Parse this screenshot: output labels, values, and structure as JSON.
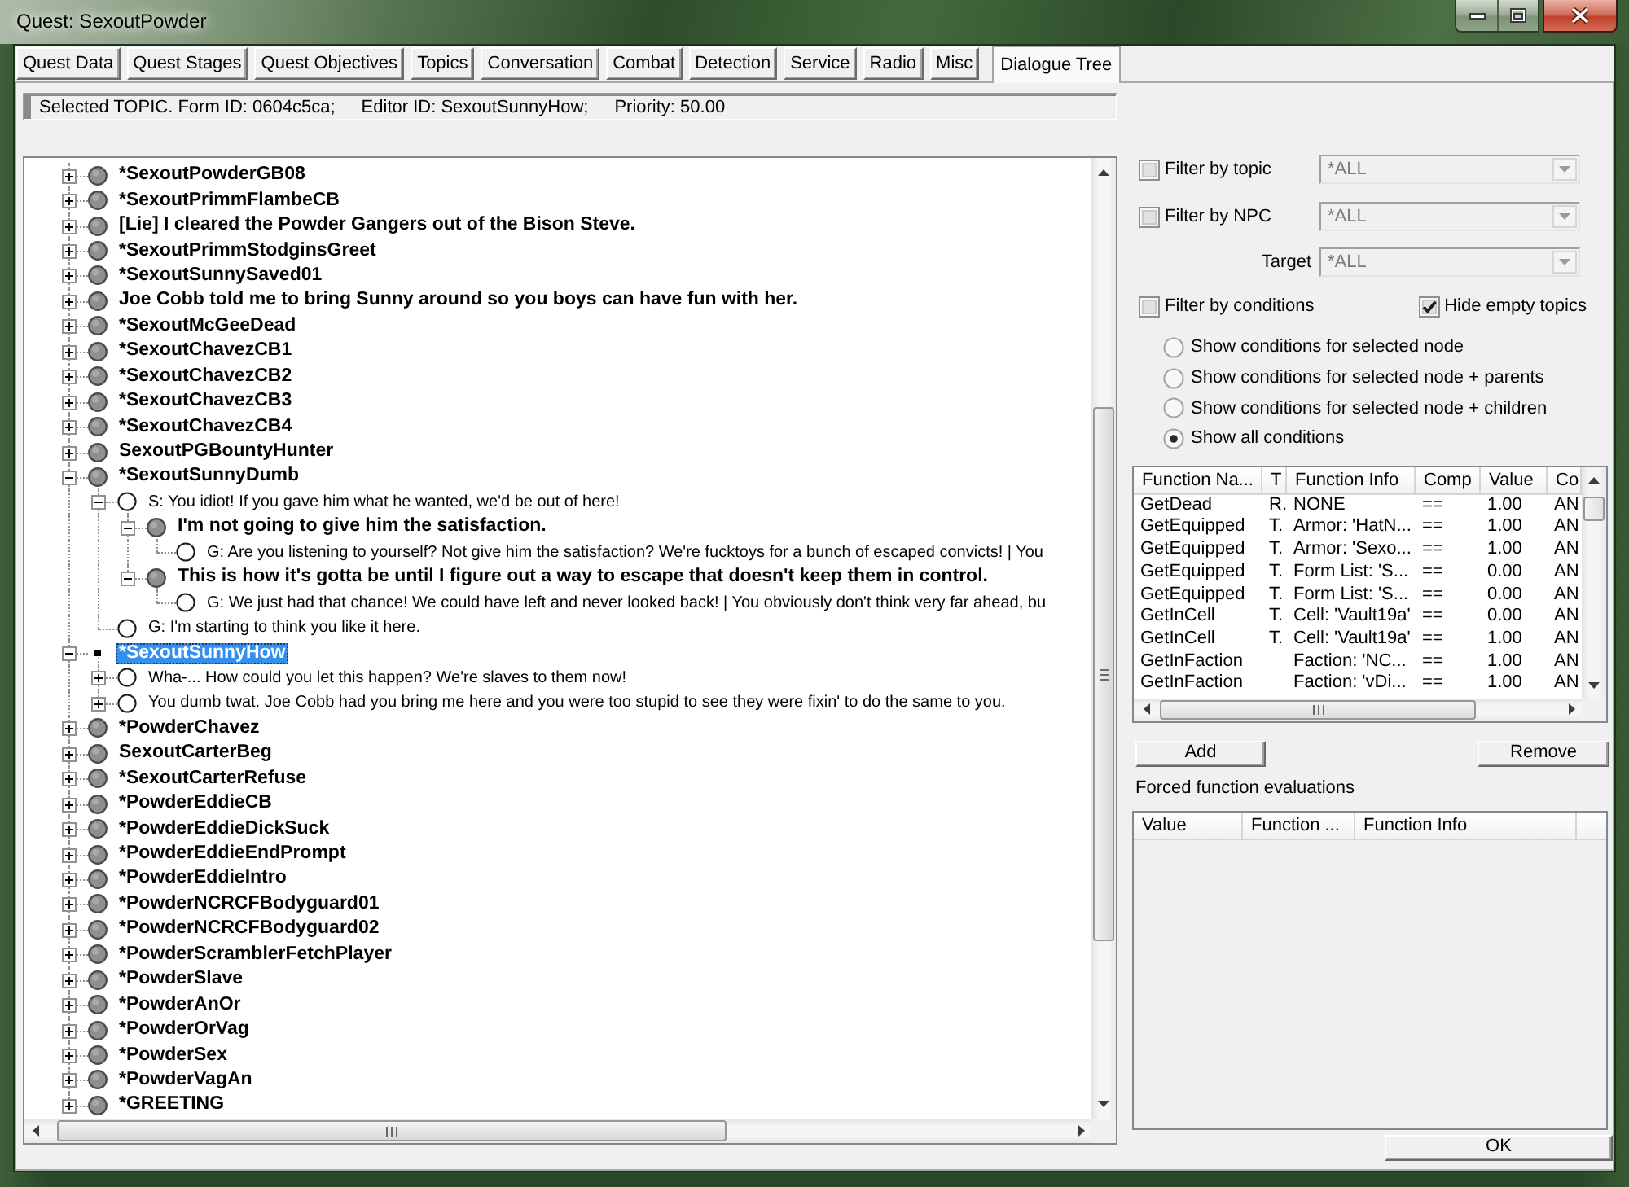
{
  "window": {
    "title": "Quest: SexoutPowder"
  },
  "tabs": [
    {
      "label": "Quest Data",
      "selected": false
    },
    {
      "label": "Quest Stages",
      "selected": false
    },
    {
      "label": "Quest Objectives",
      "selected": false
    },
    {
      "label": "Topics",
      "selected": false
    },
    {
      "label": "Conversation",
      "selected": false
    },
    {
      "label": "Combat",
      "selected": false
    },
    {
      "label": "Detection",
      "selected": false
    },
    {
      "label": "Service",
      "selected": false
    },
    {
      "label": "Radio",
      "selected": false
    },
    {
      "label": "Misc",
      "selected": false
    },
    {
      "label": "Dialogue Tree",
      "selected": true
    }
  ],
  "info_bar": [
    "Selected TOPIC. Form ID: 0604c5ca;",
    "Editor ID: SexoutSunnyHow;",
    "Priority: 50.00"
  ],
  "tree": [
    {
      "text": "*SexoutPowderGB08",
      "kind": "topic",
      "expanded": false,
      "selected": false
    },
    {
      "text": "*SexoutPrimmFlambeCB",
      "kind": "topic",
      "expanded": false,
      "selected": false
    },
    {
      "text": "[Lie] I cleared the Powder Gangers out of the Bison Steve.",
      "kind": "topic",
      "expanded": false,
      "selected": false
    },
    {
      "text": "*SexoutPrimmStodginsGreet",
      "kind": "topic",
      "expanded": false,
      "selected": false
    },
    {
      "text": "*SexoutSunnySaved01",
      "kind": "topic",
      "expanded": false,
      "selected": false
    },
    {
      "text": "Joe Cobb told me to bring Sunny around so you boys can have fun with her.",
      "kind": "topic",
      "expanded": false,
      "selected": false
    },
    {
      "text": "*SexoutMcGeeDead",
      "kind": "topic",
      "expanded": false,
      "selected": false
    },
    {
      "text": "*SexoutChavezCB1",
      "kind": "topic",
      "expanded": false,
      "selected": false
    },
    {
      "text": "*SexoutChavezCB2",
      "kind": "topic",
      "expanded": false,
      "selected": false
    },
    {
      "text": "*SexoutChavezCB3",
      "kind": "topic",
      "expanded": false,
      "selected": false
    },
    {
      "text": "*SexoutChavezCB4",
      "kind": "topic",
      "expanded": false,
      "selected": false
    },
    {
      "text": "SexoutPGBountyHunter",
      "kind": "topic",
      "expanded": false,
      "selected": false
    },
    {
      "text": "*SexoutSunnyDumb",
      "kind": "topic",
      "expanded": true,
      "selected": false,
      "children": [
        {
          "text": "S: You idiot! If you gave him what he wanted, we'd be out of here!",
          "kind": "response",
          "expanded": true,
          "selected": false,
          "children": [
            {
              "text": "I'm not going to give him the satisfaction.",
              "kind": "topic",
              "expanded": true,
              "selected": false,
              "children": [
                {
                  "text": "G: Are you listening to yourself? Not give him the satisfaction? We're fucktoys for a bunch of escaped convicts! | You",
                  "kind": "response",
                  "selected": false
                }
              ]
            },
            {
              "text": "This is how it's gotta be until I figure out a way to escape that doesn't keep them in control.",
              "kind": "topic",
              "expanded": true,
              "selected": false,
              "children": [
                {
                  "text": "G: We just had that chance! We could have left and never looked back! | You obviously don't think very far ahead, bu",
                  "kind": "response",
                  "selected": false
                }
              ]
            }
          ]
        },
        {
          "text": "G: I'm starting to think you like it here.",
          "kind": "response",
          "selected": false
        }
      ]
    },
    {
      "text": "*SexoutSunnyHow",
      "kind": "topic",
      "expanded": true,
      "selected": true,
      "children": [
        {
          "text": "Wha-... How could you let this happen? We're slaves to them now!",
          "kind": "response",
          "expanded": false,
          "selected": false
        },
        {
          "text": "You dumb twat. Joe Cobb had you bring me here and you were too stupid to see they were fixin' to do the same to you.",
          "kind": "response",
          "expanded": false,
          "selected": false
        }
      ]
    },
    {
      "text": "*PowderChavez",
      "kind": "topic",
      "expanded": false,
      "selected": false
    },
    {
      "text": "SexoutCarterBeg",
      "kind": "topic",
      "expanded": false,
      "selected": false
    },
    {
      "text": "*SexoutCarterRefuse",
      "kind": "topic",
      "expanded": false,
      "selected": false
    },
    {
      "text": "*PowderEddieCB",
      "kind": "topic",
      "expanded": false,
      "selected": false
    },
    {
      "text": "*PowderEddieDickSuck",
      "kind": "topic",
      "expanded": false,
      "selected": false
    },
    {
      "text": "*PowderEddieEndPrompt",
      "kind": "topic",
      "expanded": false,
      "selected": false
    },
    {
      "text": "*PowderEddieIntro",
      "kind": "topic",
      "expanded": false,
      "selected": false
    },
    {
      "text": "*PowderNCRCFBodyguard01",
      "kind": "topic",
      "expanded": false,
      "selected": false
    },
    {
      "text": "*PowderNCRCFBodyguard02",
      "kind": "topic",
      "expanded": false,
      "selected": false
    },
    {
      "text": "*PowderScramblerFetchPlayer",
      "kind": "topic",
      "expanded": false,
      "selected": false
    },
    {
      "text": "*PowderSlave",
      "kind": "topic",
      "expanded": false,
      "selected": false
    },
    {
      "text": "*PowderAnOr",
      "kind": "topic",
      "expanded": false,
      "selected": false
    },
    {
      "text": "*PowderOrVag",
      "kind": "topic",
      "expanded": false,
      "selected": false
    },
    {
      "text": "*PowderSex",
      "kind": "topic",
      "expanded": false,
      "selected": false
    },
    {
      "text": "*PowderVagAn",
      "kind": "topic",
      "expanded": false,
      "selected": false
    },
    {
      "text": "*GREETING",
      "kind": "topic",
      "expanded": false,
      "selected": false
    }
  ],
  "filters": {
    "topic": {
      "label": "Filter by topic",
      "checked": false,
      "dropdown": {
        "value": "*ALL",
        "disabled": true
      }
    },
    "npc": {
      "label": "Filter by NPC",
      "checked": false,
      "dropdown": {
        "value": "*ALL",
        "disabled": true
      }
    },
    "target": {
      "label": "Target",
      "dropdown": {
        "value": "*ALL",
        "disabled": true
      }
    },
    "conditions": {
      "label": "Filter by conditions",
      "checked": false
    },
    "hide_empty_topics": {
      "label": "Hide empty topics",
      "checked": true
    }
  },
  "condition_modes": [
    {
      "label": "Show conditions for selected node",
      "selected": false
    },
    {
      "label": "Show conditions for selected node + parents",
      "selected": false
    },
    {
      "label": "Show conditions for selected node + children",
      "selected": false
    },
    {
      "label": "Show all conditions",
      "selected": true
    }
  ],
  "conditions_table": {
    "columns": [
      "Function Na...",
      "T",
      "Function Info",
      "Comp",
      "Value",
      "Co"
    ],
    "rows": [
      [
        "GetDead",
        "R.",
        "NONE",
        "==",
        "1.00",
        "AN"
      ],
      [
        "GetEquipped",
        "T.",
        "Armor: 'HatN...",
        "==",
        "1.00",
        "AN"
      ],
      [
        "GetEquipped",
        "T.",
        "Armor: 'Sexo...",
        "==",
        "1.00",
        "AN"
      ],
      [
        "GetEquipped",
        "T.",
        "Form List: 'S...",
        "==",
        "0.00",
        "AN"
      ],
      [
        "GetEquipped",
        "T.",
        "Form List: 'S...",
        "==",
        "0.00",
        "AN"
      ],
      [
        "GetInCell",
        "T.",
        "Cell: 'Vault19a'",
        "==",
        "0.00",
        "AN"
      ],
      [
        "GetInCell",
        "T.",
        "Cell: 'Vault19a'",
        "==",
        "1.00",
        "AN"
      ],
      [
        "GetInFaction",
        null,
        "Faction: 'NC...",
        "==",
        "1.00",
        "AN"
      ],
      [
        "GetInFaction",
        null,
        "Faction: 'vDi...",
        "==",
        "1.00",
        "AN"
      ]
    ]
  },
  "buttons": [
    "Add",
    "Remove"
  ],
  "forced_evaluations": {
    "title": "Forced function evaluations",
    "columns": [
      "Value",
      "Function ...",
      "Function Info"
    ]
  },
  "ok_button": "OK"
}
